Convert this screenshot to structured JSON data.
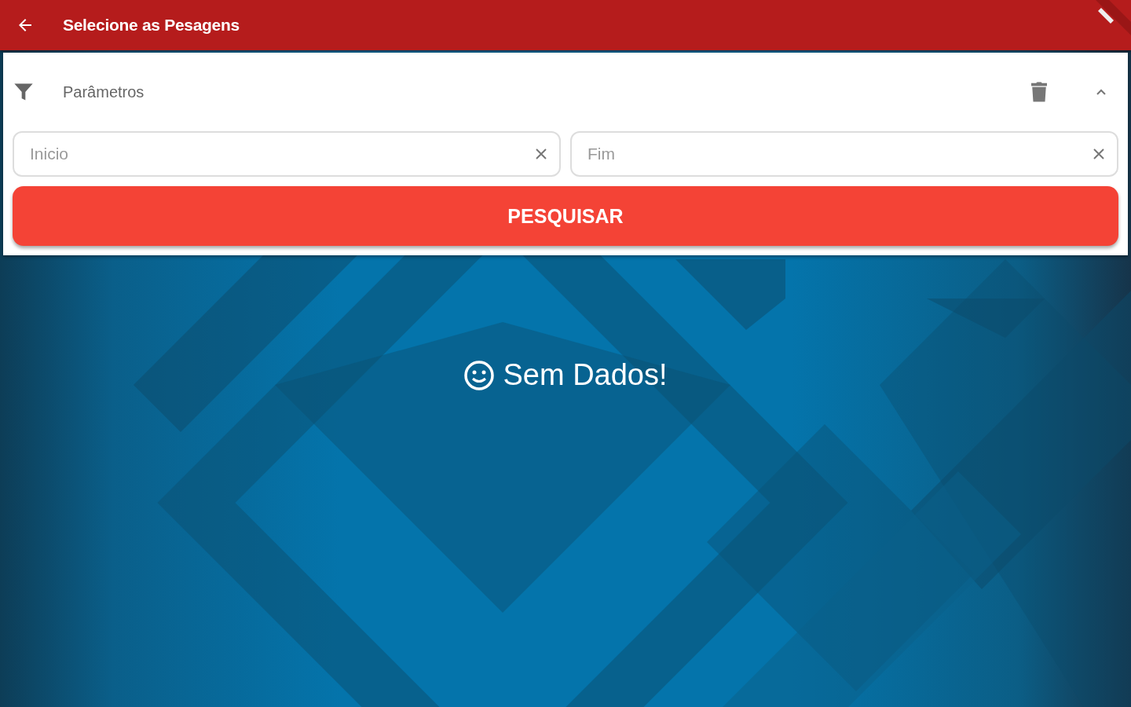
{
  "app_bar": {
    "title": "Selecione as Pesagens"
  },
  "filter_panel": {
    "title": "Parâmetros",
    "expanded": true,
    "fields": [
      {
        "placeholder": "Inicio"
      },
      {
        "placeholder": "Fim"
      }
    ],
    "search_button": "PESQUISAR"
  },
  "empty_state": {
    "message": "Sem Dados!"
  }
}
